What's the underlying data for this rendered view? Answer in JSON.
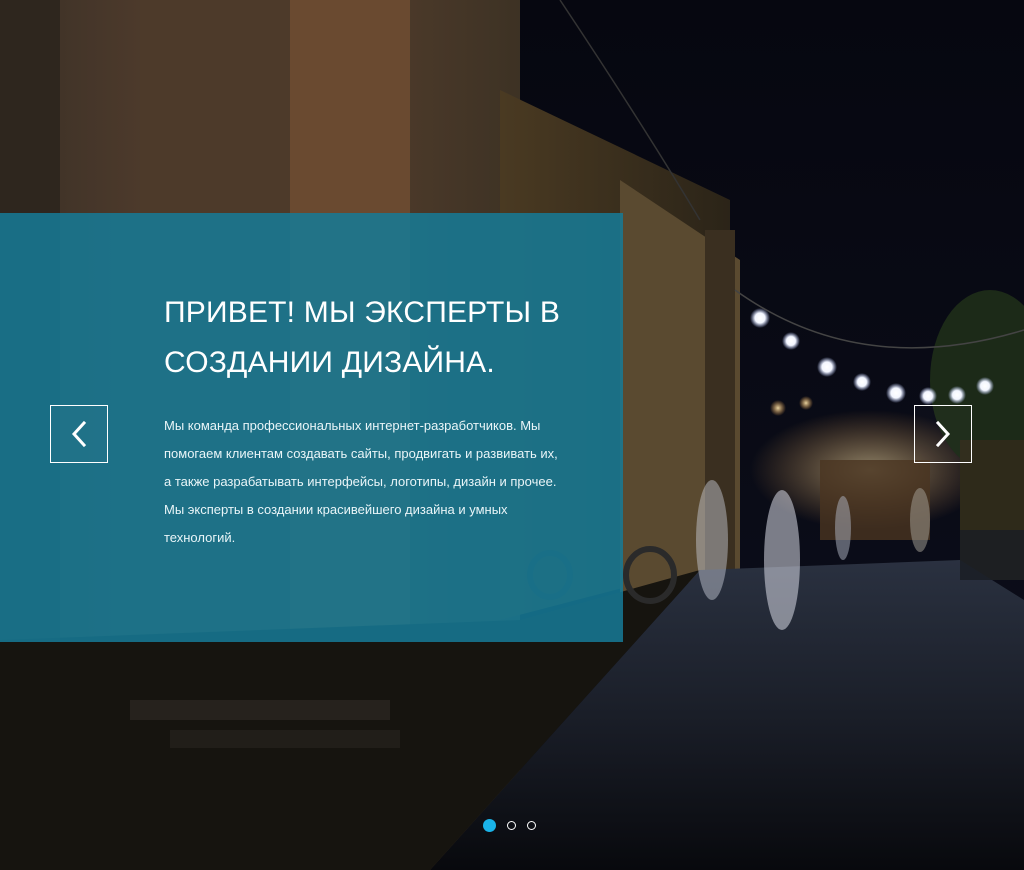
{
  "slider": {
    "title": "ПРИВЕТ! МЫ ЭКСПЕРТЫ В СОЗДАНИИ ДИЗАЙНА.",
    "text": "Мы команда профессиональных интернет-разработчиков. Мы помогаем клиентам создавать сайты, продвигать и развивать их, а также разрабатывать интерфейсы, логотипы, дизайн и прочее. Мы эксперты в создании красивейшего дизайна и умных технологий.",
    "prev_icon": "chevron-left-icon",
    "next_icon": "chevron-right-icon",
    "active_slide": 1,
    "slide_count": 3
  },
  "colors": {
    "panel": "#167a96",
    "dot_active": "#1ab3e8",
    "text": "#ffffff"
  },
  "background": {
    "scene": "night-street-photo"
  }
}
